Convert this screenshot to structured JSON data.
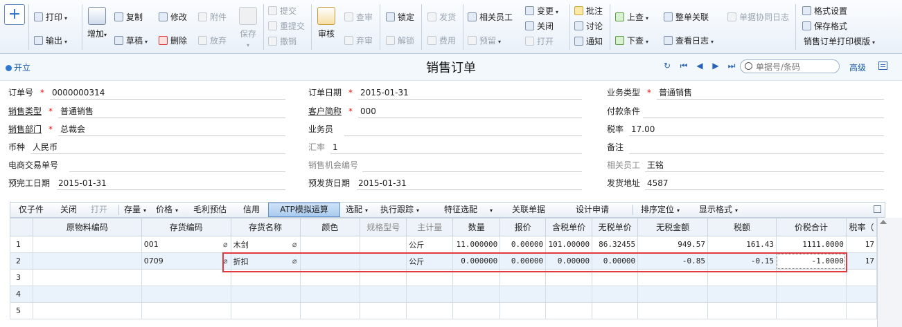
{
  "toolbar": {
    "new_icon": "plus-icon",
    "print": "打印",
    "export": "输出",
    "add": "增加",
    "copy": "复制",
    "draft": "草稿",
    "modify": "修改",
    "attachment": "附件",
    "delete": "删除",
    "abandon": "放弃",
    "save": "保存",
    "submit": "提交",
    "resubmit": "重提交",
    "withdraw": "撤销",
    "review": "审核",
    "audit_query": "查审",
    "abandon_review": "弃审",
    "lock": "锁定",
    "unlock": "解锁",
    "ship": "发货",
    "expense": "费用",
    "related_staff": "相关员工",
    "prepay": "预留",
    "change": "变更",
    "close": "关闭",
    "open": "打开",
    "annotate": "批注",
    "discuss": "讨论",
    "notify": "通知",
    "prev_query": "上查",
    "next_query": "下查",
    "whole_link": "整单关联",
    "view_log": "查看日志",
    "collab_log": "单据协同日志",
    "format_settings": "格式设置",
    "save_format": "保存格式",
    "print_template": "销售订单打印模版"
  },
  "titlebar": {
    "status": "开立",
    "title": "销售订单",
    "search_placeholder": "单据号/条码",
    "advanced": "高级"
  },
  "header_fields": [
    {
      "label": "订单号",
      "value": "0000000314",
      "required": true
    },
    {
      "label": "订单日期",
      "value": "2015-01-31",
      "required": true
    },
    {
      "label": "业务类型",
      "value": "普通销售",
      "required": true
    },
    {
      "label": "销售类型",
      "value": "普通销售",
      "required": true
    },
    {
      "label": "客户简称",
      "value": "000",
      "required": true
    },
    {
      "label": "付款条件",
      "value": ""
    },
    {
      "label": "销售部门",
      "value": "总裁会",
      "required": true
    },
    {
      "label": "业务员",
      "value": ""
    },
    {
      "label": "税率",
      "value": "17.00"
    },
    {
      "label": "币种",
      "value": "人民币"
    },
    {
      "label": "汇率",
      "value": "1"
    },
    {
      "label": "备注",
      "value": ""
    },
    {
      "label": "电商交易单号",
      "value": ""
    },
    {
      "label": "销售机会编号",
      "value": ""
    },
    {
      "label": "相关员工",
      "value": "王铭"
    },
    {
      "label": "预完工日期",
      "value": "2015-01-31"
    },
    {
      "label": "预发货日期",
      "value": "2015-01-31"
    },
    {
      "label": "发货地址",
      "value": "4587"
    }
  ],
  "detail_toolbar": {
    "sub_item": "仅子件",
    "close": "关闭",
    "open": "打开",
    "stock": "存量",
    "price": "价格",
    "margin_estimate": "毛利预估",
    "credit": "信用",
    "atp": "ATP模拟运算",
    "pick": "选配",
    "exec_trace": "执行跟踪",
    "feature_pick": "特征选配",
    "linked_docs": "关联单据",
    "design_request": "设计申请",
    "sort_locate": "排序定位",
    "display_format": "显示格式"
  },
  "grid": {
    "columns": [
      "原物料编码",
      "存货编码",
      "存货名称",
      "颜色",
      "规格型号",
      "主计量",
      "数量",
      "报价",
      "含税单价",
      "无税单价",
      "无税金额",
      "税额",
      "价税合计",
      "税率（"
    ],
    "rows": [
      {
        "no": "1",
        "material": "",
        "code": "001",
        "name": "木剑",
        "color": "",
        "spec": "",
        "unit": "公斤",
        "qty": "11.000000",
        "quote": "0.00000",
        "tax_price": "101.00000",
        "net_price": "86.32455",
        "net_amount": "949.57",
        "tax": "161.43",
        "total": "1111.0000",
        "rate": "17"
      },
      {
        "no": "2",
        "material": "",
        "code": "0709",
        "name": "折扣",
        "color": "",
        "spec": "",
        "unit": "公斤",
        "qty": "0.000000",
        "quote": "0.00000",
        "tax_price": "0.00000",
        "net_price": "0.00000",
        "net_amount": "-0.85",
        "tax": "-0.15",
        "total": "-1.0000",
        "rate": "17"
      },
      {
        "no": "3"
      },
      {
        "no": "4"
      },
      {
        "no": "5"
      }
    ]
  }
}
